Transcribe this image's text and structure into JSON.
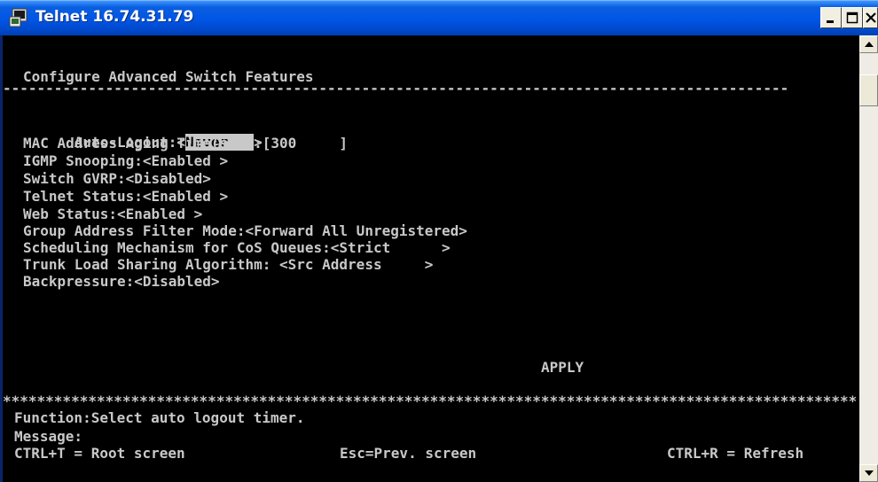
{
  "window": {
    "title": "Telnet 16.74.31.79",
    "controls": {
      "minimize": "_",
      "maximize": "□",
      "close": "×"
    }
  },
  "screen": {
    "header": "Configure Advanced Switch Features",
    "dash_rule": "--------------------------------------------------------------------------------------------",
    "auto_logout_label": "Auto-Logout:<",
    "auto_logout_value": "Never   ",
    "auto_logout_end": ">",
    "settings": [
      "MAC Address Aging Time(sec):[300     ]",
      "IGMP Snooping:<Enabled >",
      "Switch GVRP:<Disabled>",
      "Telnet Status:<Enabled >",
      "Web Status:<Enabled >",
      "Group Address Filter Mode:<Forward All Unregistered>",
      "Scheduling Mechanism for CoS Queues:<Strict      >",
      "Trunk Load Sharing Algorithm: <Src Address     >",
      "Backpressure:<Disabled>"
    ],
    "apply_label": "APPLY",
    "star_rule": "****************************************************************************************************",
    "function_line": "Function:Select auto logout timer.",
    "message_line": "Message:",
    "footer_root": "CTRL+T = Root screen",
    "footer_prev": "Esc=Prev. screen",
    "footer_refresh": "CTRL+R = Refresh"
  },
  "colors": {
    "titlebar": "#0055e5",
    "terminal_bg": "#000000",
    "terminal_fg": "#c8c8c8"
  },
  "icons": {
    "title": "telnet-terminal-icon",
    "scroll_up": "arrow-up-icon",
    "scroll_down": "arrow-down-icon"
  }
}
